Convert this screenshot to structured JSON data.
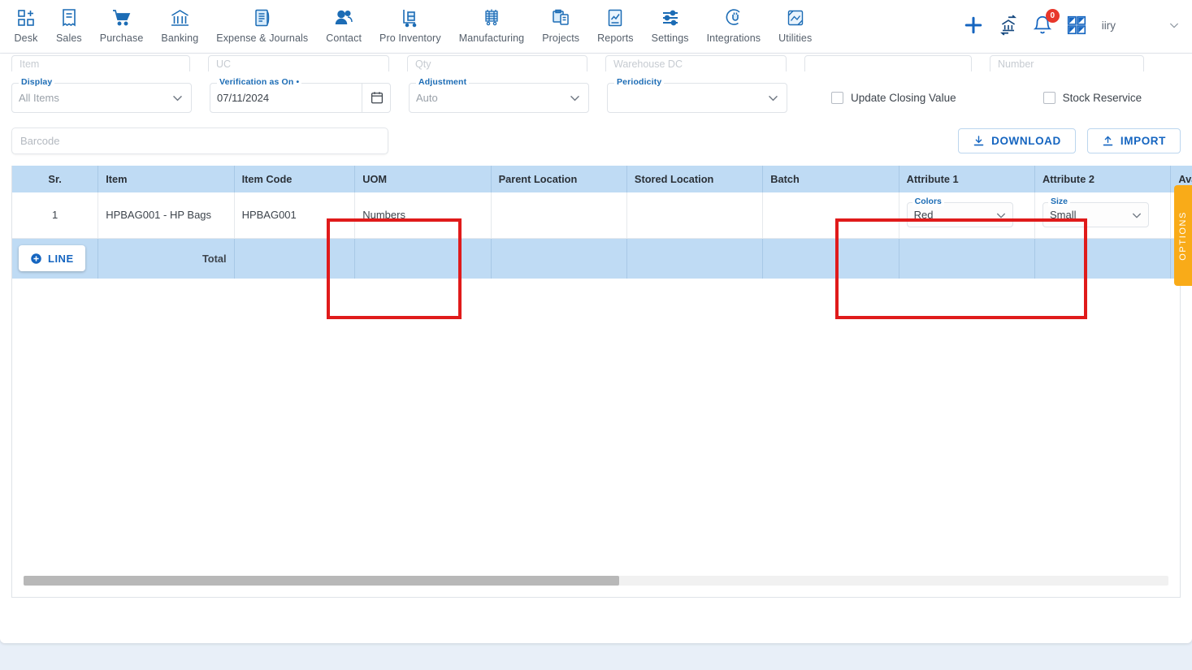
{
  "nav": {
    "items": [
      {
        "label": "Desk",
        "icon": "desk-grid-plus-icon"
      },
      {
        "label": "Sales",
        "icon": "sales-receipt-icon"
      },
      {
        "label": "Purchase",
        "icon": "purchase-cart-icon"
      },
      {
        "label": "Banking",
        "icon": "banking-bank-icon"
      },
      {
        "label": "Expense & Journals",
        "icon": "expense-journal-icon"
      },
      {
        "label": "Contact",
        "icon": "contact-people-icon"
      },
      {
        "label": "Pro Inventory",
        "icon": "pro-inventory-trolley-icon"
      },
      {
        "label": "Manufacturing",
        "icon": "manufacturing-machine-icon"
      },
      {
        "label": "Projects",
        "icon": "projects-clipboard-icon"
      },
      {
        "label": "Reports",
        "icon": "reports-chart-icon"
      },
      {
        "label": "Settings",
        "icon": "settings-sliders-icon"
      },
      {
        "label": "Integrations",
        "icon": "integrations-plug-icon"
      },
      {
        "label": "Utilities",
        "icon": "utilities-tools-icon"
      }
    ],
    "right": {
      "add_icon": "plus-icon",
      "transfer_icon": "bank-transfer-icon",
      "bell_icon": "notification-bell-icon",
      "notification_count": "0",
      "apps_icon": "apps-grid-icon",
      "username": "iiry",
      "caret_icon": "chevron-down-icon"
    }
  },
  "filters": {
    "top_row_stubs": [
      "Item",
      "UC",
      "Qty",
      "Warehouse DC",
      "",
      "Number"
    ],
    "display": {
      "label": "Display",
      "value": "All Items",
      "chevron": "chevron-down-icon"
    },
    "verification": {
      "label": "Verification as On •",
      "value": "07/11/2024",
      "icon": "calendar-icon"
    },
    "adjustment": {
      "label": "Adjustment",
      "value": "Auto",
      "chevron": "chevron-down-icon"
    },
    "periodicity": {
      "label": "Periodicity",
      "value": "",
      "chevron": "chevron-down-icon"
    },
    "update_closing_value": {
      "label": "Update Closing Value",
      "checked": false
    },
    "stock_reservice": {
      "label": "Stock Reservice",
      "checked": false
    }
  },
  "toolbar": {
    "barcode_placeholder": "Barcode",
    "barcode_value": "",
    "download_label": "DOWNLOAD",
    "download_icon": "download-icon",
    "import_label": "IMPORT",
    "import_icon": "upload-icon"
  },
  "table": {
    "headers": [
      "Sr.",
      "Item",
      "Item Code",
      "UOM",
      "Parent Location",
      "Stored Location",
      "Batch",
      "Attribute 1",
      "Attribute 2",
      "Avail Qty"
    ],
    "rows": [
      {
        "sr": "1",
        "item": "HPBAG001 - HP Bags",
        "item_code": "HPBAG001",
        "uom": "Numbers",
        "parent_location": "",
        "stored_location": "",
        "batch": "",
        "attribute1": {
          "label": "Colors",
          "value": "Red",
          "chevron": "chevron-down-icon"
        },
        "attribute2": {
          "label": "Size",
          "value": "Small",
          "chevron": "chevron-down-icon"
        },
        "avail_qty": ""
      }
    ],
    "footer": {
      "line_button": "LINE",
      "line_icon": "circle-plus-icon",
      "total_label": "Total"
    }
  },
  "options_tab": {
    "label": "OPTIONS",
    "color": "#f9ab18"
  },
  "annotations": {
    "highlight_color": "#e01b1b",
    "boxes": [
      "uom-column-highlight",
      "attributes-columns-highlight"
    ]
  },
  "scrollbar": {
    "position_percent": "52"
  }
}
